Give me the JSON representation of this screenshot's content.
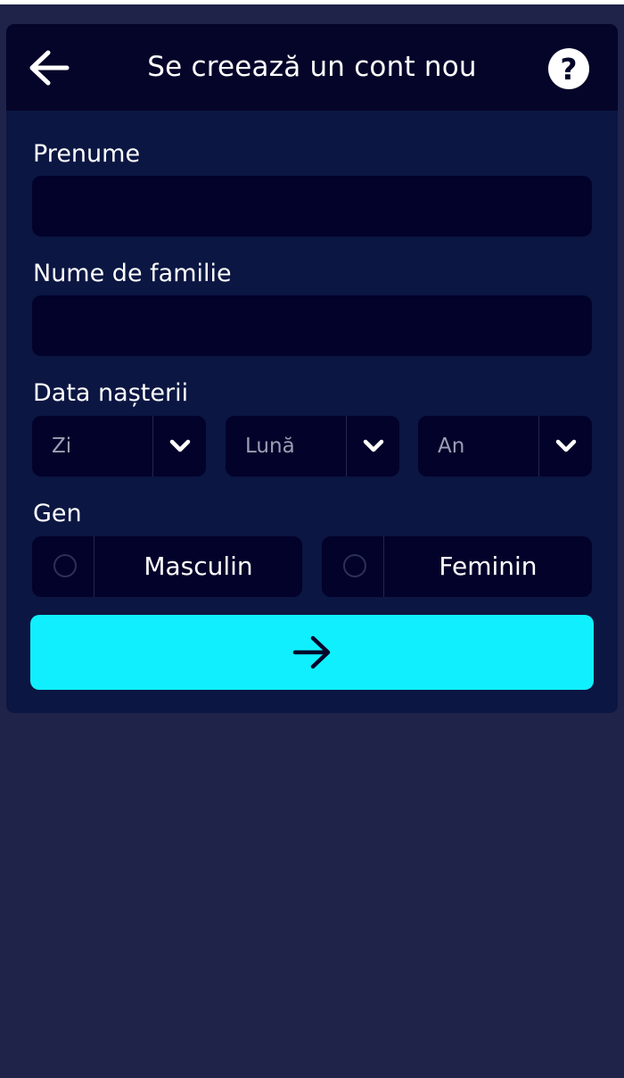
{
  "header": {
    "title": "Se creează un cont nou",
    "back_icon": "arrow-left-icon",
    "help_icon": "question-mark-icon",
    "help_glyph": "?"
  },
  "form": {
    "first_name": {
      "label": "Prenume",
      "value": "",
      "placeholder": ""
    },
    "last_name": {
      "label": "Nume de familie",
      "value": "",
      "placeholder": ""
    },
    "birth_date": {
      "label": "Data nașterii",
      "day": {
        "selected": "Zi"
      },
      "month": {
        "selected": "Lună"
      },
      "year": {
        "selected": "An"
      },
      "chevron_icon": "chevron-down-icon"
    },
    "gender": {
      "label": "Gen",
      "options": [
        {
          "label": "Masculin",
          "selected": false
        },
        {
          "label": "Feminin",
          "selected": false
        }
      ]
    },
    "submit_icon": "arrow-right-icon"
  },
  "colors": {
    "page_background": "#1f2249",
    "card_background": "#0b1642",
    "header_background": "#05052a",
    "field_background": "#03022a",
    "accent": "#10effd",
    "text": "#ffffff",
    "placeholder_text": "#9c9fb5"
  }
}
